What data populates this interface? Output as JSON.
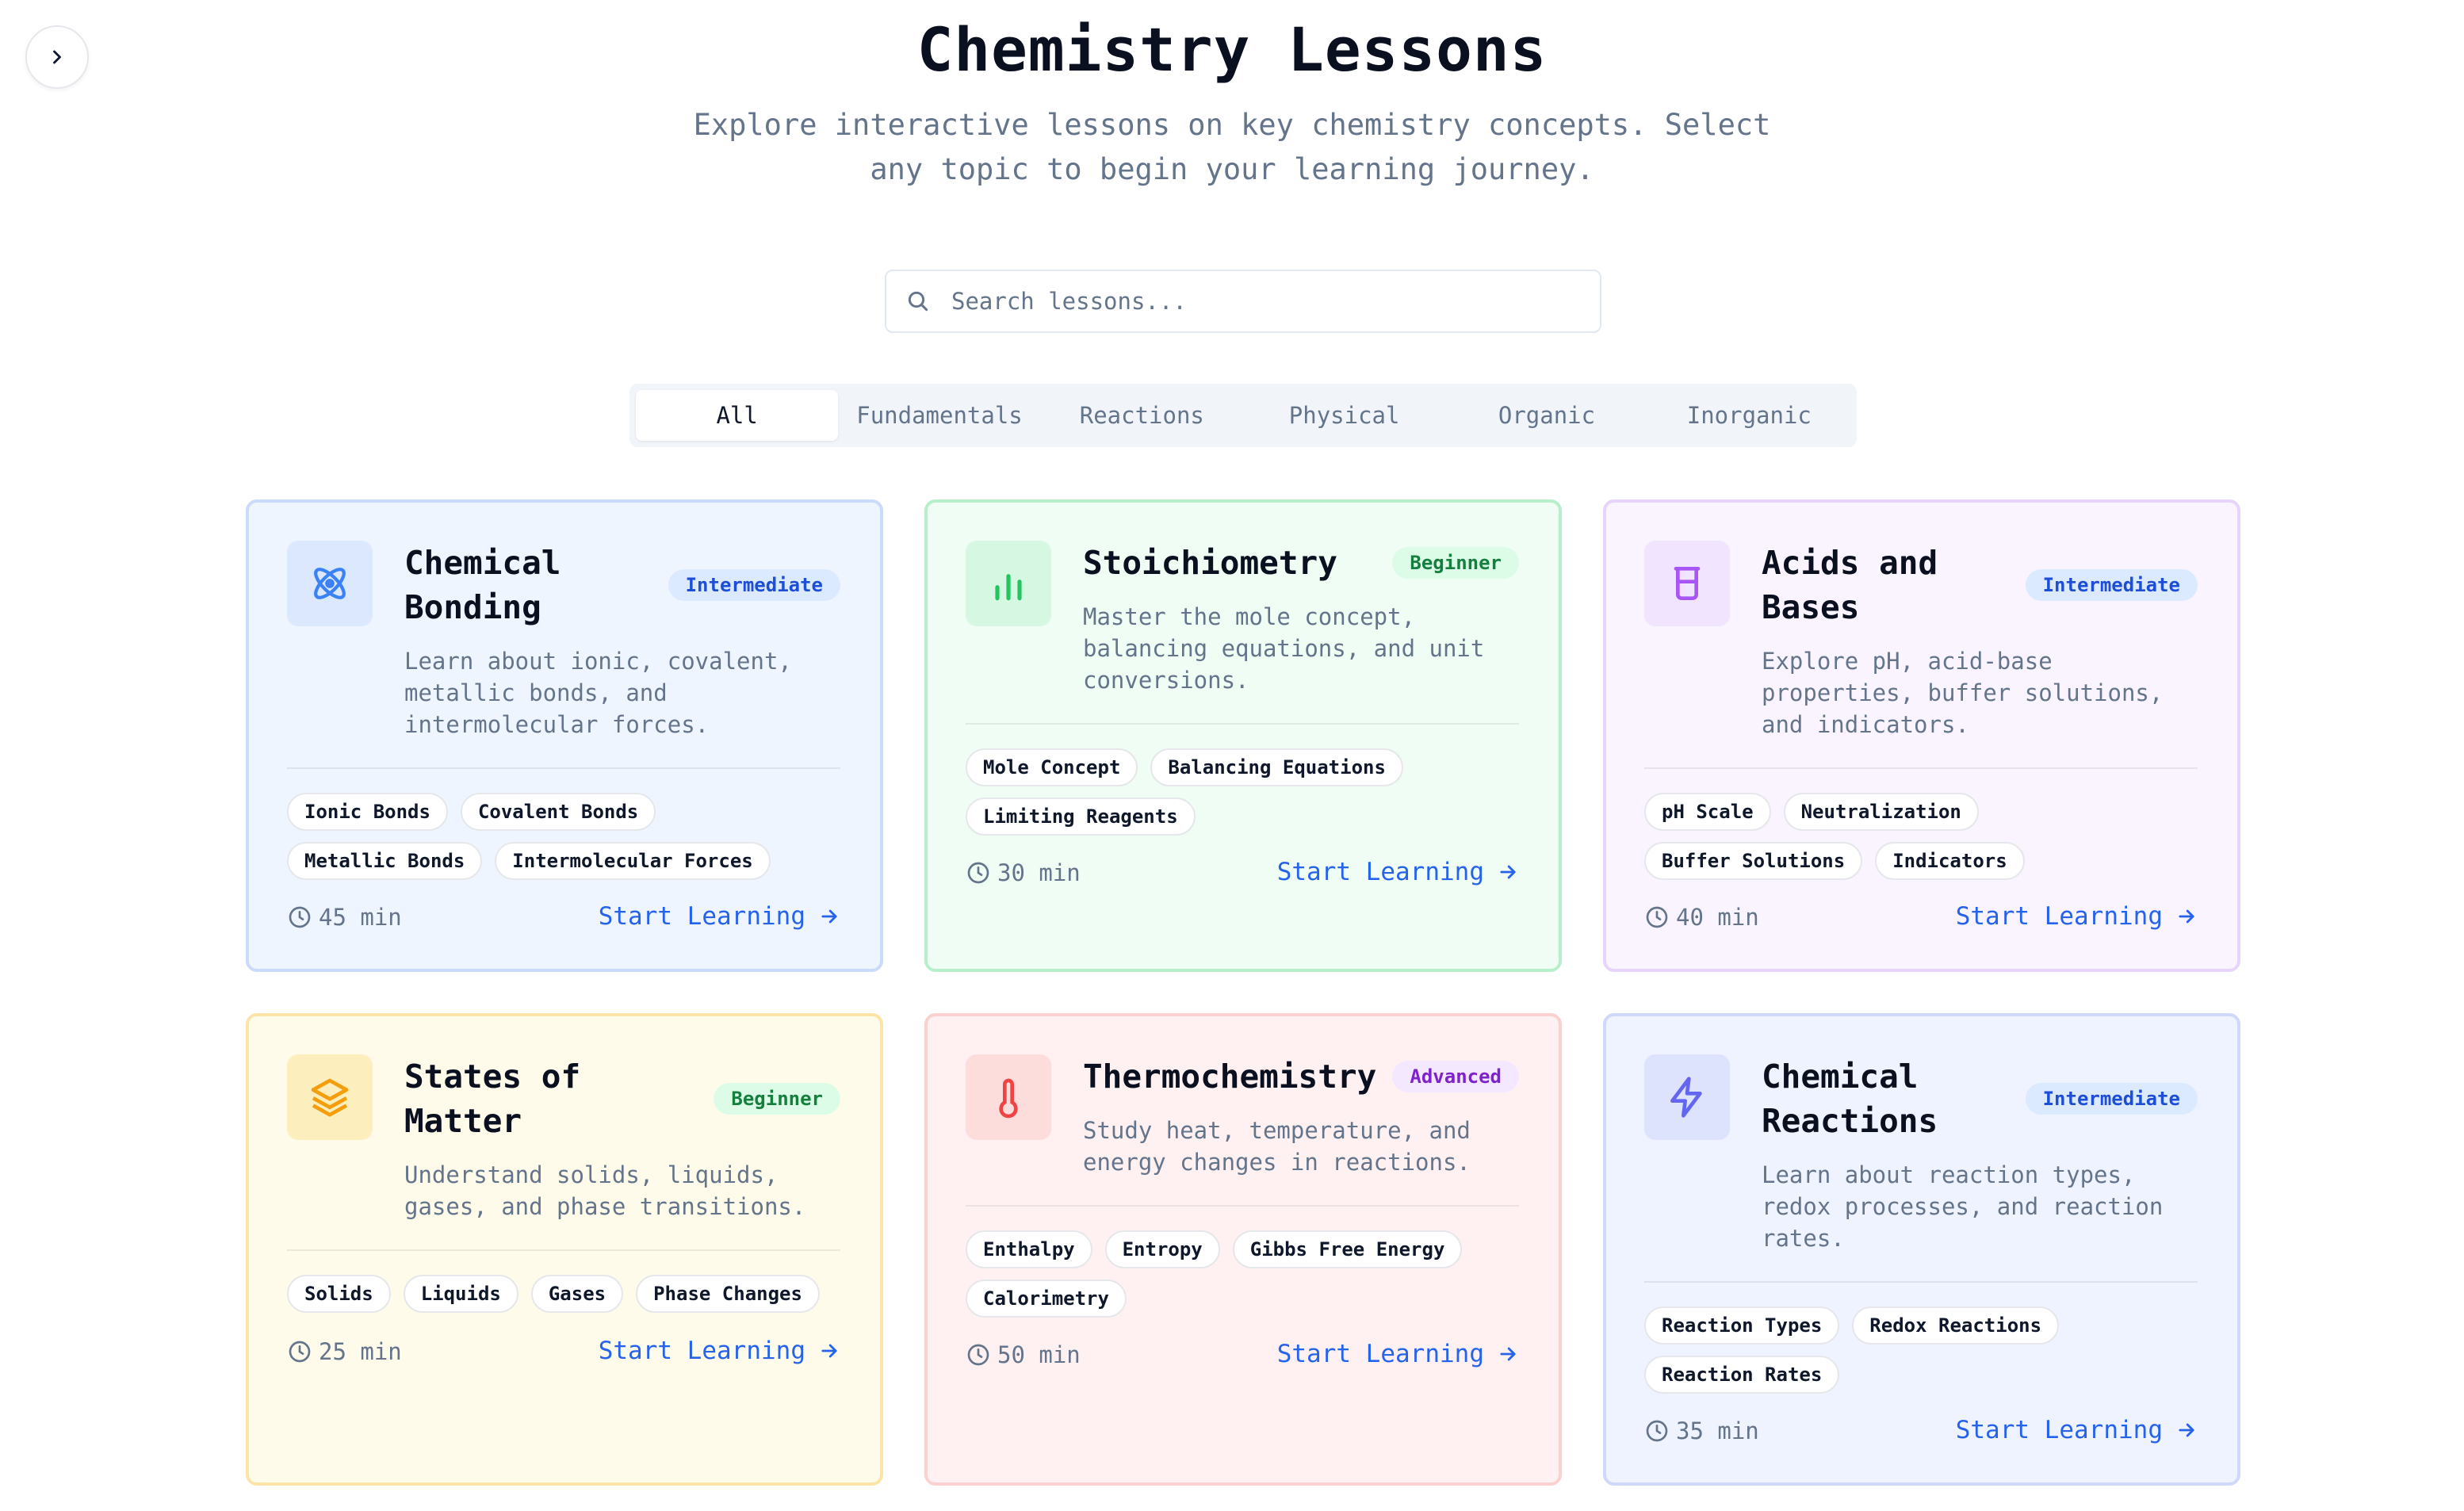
{
  "header": {
    "title": "Chemistry Lessons",
    "subtitle_line1": "Explore interactive lessons on key chemistry concepts. Select",
    "subtitle_line2": "any topic to begin your learning journey."
  },
  "search": {
    "placeholder": "Search lessons..."
  },
  "tabs": [
    {
      "label": "All",
      "active": true
    },
    {
      "label": "Fundamentals"
    },
    {
      "label": "Reactions"
    },
    {
      "label": "Physical"
    },
    {
      "label": "Organic"
    },
    {
      "label": "Inorganic"
    }
  ],
  "cards": [
    {
      "title": "Chemical Bonding",
      "badge": "Intermediate",
      "description": "Learn about ionic, covalent, metallic bonds, and intermolecular forces.",
      "tags": [
        "Ionic Bonds",
        "Covalent Bonds",
        "Metallic Bonds",
        "Intermolecular Forces"
      ],
      "duration": "45 min",
      "cta": "Start Learning",
      "icon": "atom-icon",
      "accent": "#3b82f6"
    },
    {
      "title": "Stoichiometry",
      "badge": "Beginner",
      "description": "Master the mole concept, balancing equations, and unit conversions.",
      "tags": [
        "Mole Concept",
        "Balancing Equations",
        "Limiting Reagents"
      ],
      "duration": "30 min",
      "cta": "Start Learning",
      "icon": "bar-chart-icon",
      "accent": "#22c55e"
    },
    {
      "title": "Acids and Bases",
      "badge": "Intermediate",
      "description": "Explore pH, acid-base properties, buffer solutions, and indicators.",
      "tags": [
        "pH Scale",
        "Neutralization",
        "Buffer Solutions",
        "Indicators"
      ],
      "duration": "40 min",
      "cta": "Start Learning",
      "icon": "beaker-icon",
      "accent": "#a855f7"
    },
    {
      "title": "States of Matter",
      "badge": "Beginner",
      "description": "Understand solids, liquids, gases, and phase transitions.",
      "tags": [
        "Solids",
        "Liquids",
        "Gases",
        "Phase Changes"
      ],
      "duration": "25 min",
      "cta": "Start Learning",
      "icon": "layers-icon",
      "accent": "#f59e0b"
    },
    {
      "title": "Thermochemistry",
      "badge": "Advanced",
      "description": "Study heat, temperature, and energy changes in reactions.",
      "tags": [
        "Enthalpy",
        "Entropy",
        "Gibbs Free Energy",
        "Calorimetry"
      ],
      "duration": "50 min",
      "cta": "Start Learning",
      "icon": "thermometer-icon",
      "accent": "#ef4444"
    },
    {
      "title": "Chemical Reactions",
      "badge": "Intermediate",
      "description": "Learn about reaction types, redox processes, and reaction rates.",
      "tags": [
        "Reaction Types",
        "Redox Reactions",
        "Reaction Rates"
      ],
      "duration": "35 min",
      "cta": "Start Learning",
      "icon": "lightning-icon",
      "accent": "#6366f1"
    }
  ]
}
